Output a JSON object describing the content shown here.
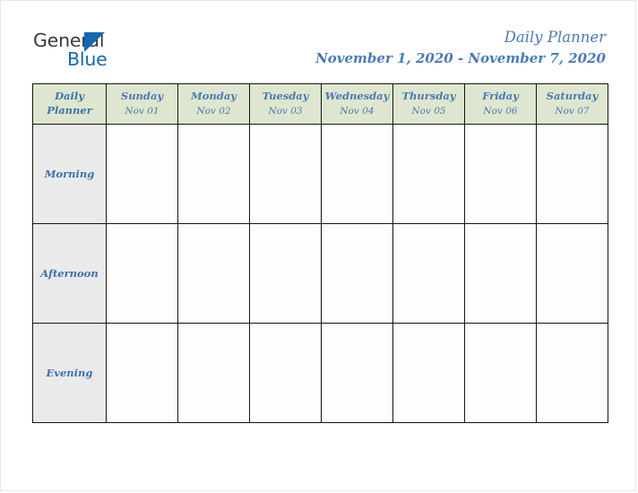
{
  "logo": {
    "text_primary": "General",
    "text_secondary": "Blue",
    "triangle_icon": "triangle-right-icon",
    "color_primary": "#3a3a3a",
    "color_secondary": "#1268b3"
  },
  "header": {
    "title": "Daily Planner",
    "date_range": "November 1, 2020 - November 7, 2020",
    "accent_color": "#4a7ab5"
  },
  "table": {
    "corner_label_line1": "Daily",
    "corner_label_line2": "Planner",
    "header_bg": "#dfe6cf",
    "rowlabel_bg": "#eaeaea",
    "cell_bg": "#fdfdfd",
    "border_color": "#141414",
    "columns": [
      {
        "day": "Sunday",
        "date": "Nov 01"
      },
      {
        "day": "Monday",
        "date": "Nov 02"
      },
      {
        "day": "Tuesday",
        "date": "Nov 03"
      },
      {
        "day": "Wednesday",
        "date": "Nov 04"
      },
      {
        "day": "Thursday",
        "date": "Nov 05"
      },
      {
        "day": "Friday",
        "date": "Nov 06"
      },
      {
        "day": "Saturday",
        "date": "Nov 07"
      }
    ],
    "rows": [
      {
        "label": "Morning",
        "cells": [
          "",
          "",
          "",
          "",
          "",
          "",
          ""
        ]
      },
      {
        "label": "Afternoon",
        "cells": [
          "",
          "",
          "",
          "",
          "",
          "",
          ""
        ]
      },
      {
        "label": "Evening",
        "cells": [
          "",
          "",
          "",
          "",
          "",
          "",
          ""
        ]
      }
    ]
  }
}
